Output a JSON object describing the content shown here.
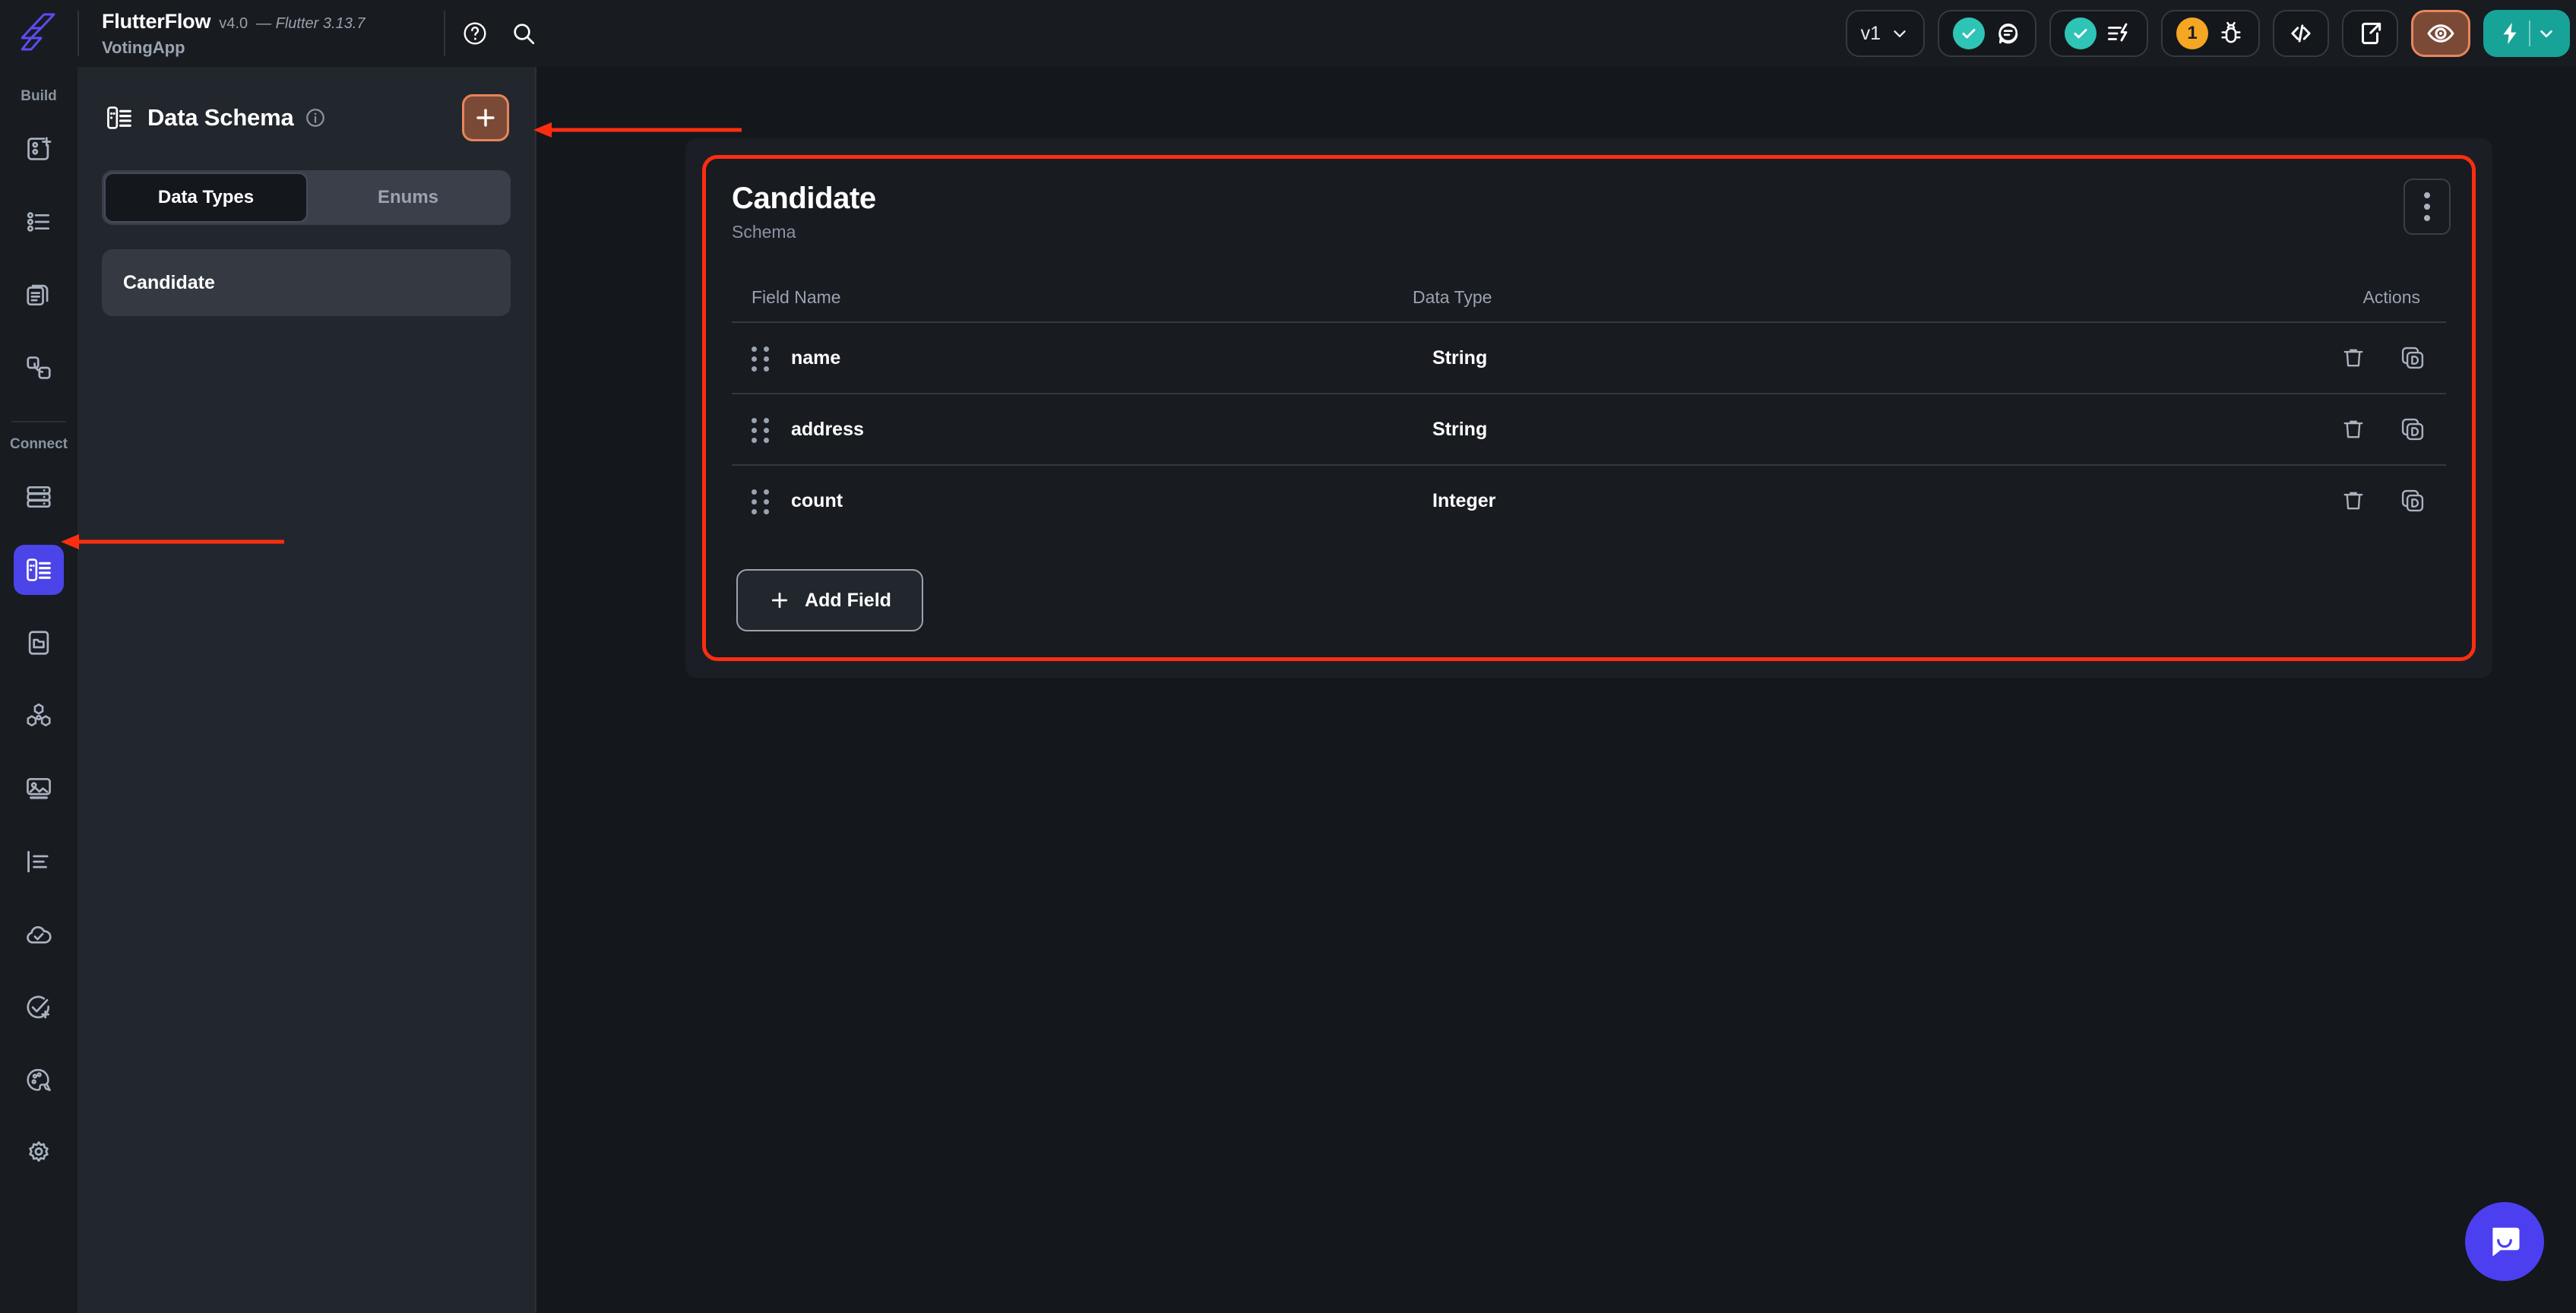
{
  "topbar": {
    "logo": "flutterflow-logo",
    "brand_name": "FlutterFlow",
    "version": "v4.0",
    "flutter_version": "— Flutter 3.13.7",
    "project_name": "VotingApp",
    "help_icon": "help-circle-icon",
    "search_icon": "search-icon",
    "version_selector": "v1",
    "chevron": "⌄",
    "issue_count": "1",
    "icons": {
      "comment": "comment-icon",
      "check": "check-icon",
      "lightning": "lightning-icon",
      "bug": "bug-icon",
      "code": "code-icon",
      "share": "share-icon",
      "preview": "eye-icon",
      "run": "lightning-bolt-icon"
    },
    "accent_orange": "#e8855c",
    "accent_teal": "#2ec4b6",
    "accent_amber": "#f5a623"
  },
  "rail": {
    "sections": [
      {
        "label": "Build",
        "items": [
          {
            "name": "page-selector",
            "icon": "add-page-icon",
            "active": false
          },
          {
            "name": "widget-tree",
            "icon": "list-tree-icon",
            "active": false
          },
          {
            "name": "components",
            "icon": "documents-icon",
            "active": false
          },
          {
            "name": "app-state",
            "icon": "linked-pages-icon",
            "active": false
          }
        ]
      },
      {
        "label": "Connect",
        "items": [
          {
            "name": "firestore",
            "icon": "database-icon",
            "active": false
          },
          {
            "name": "data-schema",
            "icon": "data-schema-icon",
            "active": true
          },
          {
            "name": "local-storage",
            "icon": "folder-device-icon",
            "active": false
          },
          {
            "name": "api-calls",
            "icon": "hexagon-group-icon",
            "active": false
          },
          {
            "name": "media-assets",
            "icon": "image-icon",
            "active": false
          },
          {
            "name": "app-settings-list",
            "icon": "align-list-icon",
            "active": false
          },
          {
            "name": "deployment",
            "icon": "cloud-check-icon",
            "active": false
          },
          {
            "name": "tests",
            "icon": "check-circle-plus-icon",
            "active": false
          },
          {
            "name": "theme",
            "icon": "palette-icon",
            "active": false
          },
          {
            "name": "settings",
            "icon": "gear-icon",
            "active": false
          }
        ]
      }
    ]
  },
  "panel": {
    "icon": "data-schema-icon",
    "title": "Data Schema",
    "info_icon": "info-icon",
    "add_button": "+",
    "tabs": [
      {
        "label": "Data Types",
        "active": true
      },
      {
        "label": "Enums",
        "active": false
      }
    ],
    "data_types": [
      {
        "label": "Candidate",
        "selected": true
      }
    ]
  },
  "card": {
    "title": "Candidate",
    "subtitle": "Schema",
    "menu_icon": "kebab-menu-icon",
    "border_color": "#ff2d10",
    "columns": [
      "Field Name",
      "Data Type",
      "Actions"
    ],
    "fields": [
      {
        "name": "name",
        "type": "String"
      },
      {
        "name": "address",
        "type": "String"
      },
      {
        "name": "count",
        "type": "Integer"
      }
    ],
    "row_actions": [
      {
        "name": "delete",
        "icon": "trash-icon"
      },
      {
        "name": "duplicate",
        "icon": "duplicate-d-icon"
      }
    ],
    "add_field_label": "Add Field",
    "add_field_icon": "plus-icon"
  },
  "annotations": {
    "arrow_color": "#ff2d10",
    "arrow_to_add_button": "arrow-pointing-to-add-data-type",
    "arrow_to_rail_item": "arrow-pointing-to-data-schema-nav"
  },
  "chat": {
    "icon": "chat-bubble-icon",
    "color": "#4b3ff0"
  }
}
